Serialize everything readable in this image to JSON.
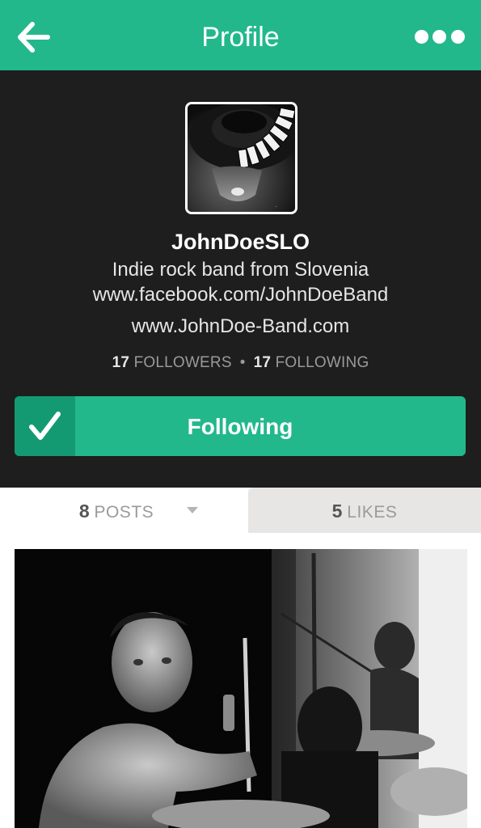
{
  "header": {
    "title": "Profile",
    "back_icon": "arrow-left-icon",
    "more_icon": "more-dots-icon"
  },
  "profile": {
    "username": "JohnDoeSLO",
    "bio_line1": "Indie rock band from Slovenia",
    "bio_line2": "www.facebook.com/JohnDoeBand",
    "bio_line3": "www.JohnDoe-Band.com",
    "followers_count": "17",
    "followers_label": "FOLLOWERS",
    "following_count": "17",
    "following_label": "FOLLOWING",
    "stats_separator": "•"
  },
  "follow_button": {
    "label": "Following",
    "icon": "checkmark-icon"
  },
  "tabs": [
    {
      "count": "8",
      "label": "POSTS",
      "active": true
    },
    {
      "count": "5",
      "label": "LIKES",
      "active": false
    }
  ],
  "colors": {
    "accent": "#22b88c",
    "accent_dark": "#149a72",
    "profile_bg": "#1e1e1e"
  }
}
